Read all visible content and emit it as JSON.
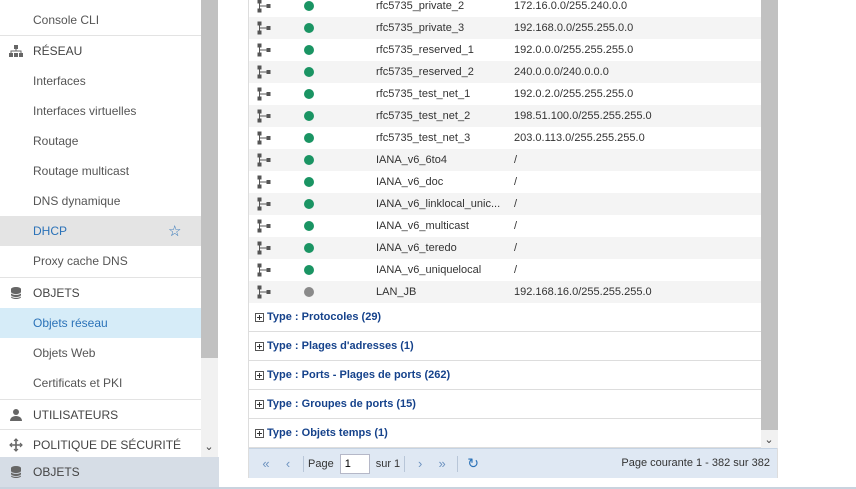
{
  "sidebar": {
    "items": [
      {
        "label": "Console CLI",
        "kind": "sub"
      },
      {
        "label": "RÉSEAU",
        "kind": "cat",
        "icon": "network-icon"
      },
      {
        "label": "Interfaces",
        "kind": "sub"
      },
      {
        "label": "Interfaces virtuelles",
        "kind": "sub"
      },
      {
        "label": "Routage",
        "kind": "sub"
      },
      {
        "label": "Routage multicast",
        "kind": "sub"
      },
      {
        "label": "DNS dynamique",
        "kind": "sub"
      },
      {
        "label": "DHCP",
        "kind": "sub",
        "state": "favorite"
      },
      {
        "label": "Proxy cache DNS",
        "kind": "sub"
      },
      {
        "label": "OBJETS",
        "kind": "cat",
        "icon": "database-icon"
      },
      {
        "label": "Objets réseau",
        "kind": "sub",
        "state": "selected"
      },
      {
        "label": "Objets Web",
        "kind": "sub"
      },
      {
        "label": "Certificats et PKI",
        "kind": "sub"
      },
      {
        "label": "UTILISATEURS",
        "kind": "cat",
        "icon": "user-icon"
      },
      {
        "label": "POLITIQUE DE SÉCURITÉ",
        "kind": "cat",
        "icon": "arrows-icon"
      }
    ],
    "footer_label": "OBJETS",
    "footer_icon": "database-icon",
    "favorite_icon": "star-icon"
  },
  "table": {
    "rows": [
      {
        "name": "rfc5735_private_2",
        "address": "172.16.0.0/255.240.0.0",
        "status": "green"
      },
      {
        "name": "rfc5735_private_3",
        "address": "192.168.0.0/255.255.0.0",
        "status": "green"
      },
      {
        "name": "rfc5735_reserved_1",
        "address": "192.0.0.0/255.255.255.0",
        "status": "green"
      },
      {
        "name": "rfc5735_reserved_2",
        "address": "240.0.0.0/240.0.0.0",
        "status": "green"
      },
      {
        "name": "rfc5735_test_net_1",
        "address": "192.0.2.0/255.255.255.0",
        "status": "green"
      },
      {
        "name": "rfc5735_test_net_2",
        "address": "198.51.100.0/255.255.255.0",
        "status": "green"
      },
      {
        "name": "rfc5735_test_net_3",
        "address": "203.0.113.0/255.255.255.0",
        "status": "green"
      },
      {
        "name": "IANA_v6_6to4",
        "address": "/",
        "status": "green"
      },
      {
        "name": "IANA_v6_doc",
        "address": "/",
        "status": "green"
      },
      {
        "name": "IANA_v6_linklocal_unic...",
        "address": "/",
        "status": "green"
      },
      {
        "name": "IANA_v6_multicast",
        "address": "/",
        "status": "green"
      },
      {
        "name": "IANA_v6_teredo",
        "address": "/",
        "status": "green"
      },
      {
        "name": "IANA_v6_uniquelocal",
        "address": "/",
        "status": "green"
      },
      {
        "name": "LAN_JB",
        "address": "192.168.16.0/255.255.255.0",
        "status": "grey"
      }
    ],
    "groups": [
      "Type : Protocoles (29)",
      "Type : Plages d'adresses (1)",
      "Type : Ports - Plages de ports (262)",
      "Type : Groupes de ports (15)",
      "Type : Objets temps (1)"
    ],
    "status_colors": {
      "green": "#1a9463",
      "grey": "#8a8a8a"
    }
  },
  "pager": {
    "page_label": "Page",
    "page_value": "1",
    "of_label": "sur 1",
    "status": "Page courante 1 - 382 sur 382",
    "first_icon": "double-chevron-left-icon",
    "prev_icon": "chevron-left-icon",
    "next_icon": "chevron-right-icon",
    "last_icon": "double-chevron-right-icon",
    "refresh_icon": "refresh-icon"
  }
}
